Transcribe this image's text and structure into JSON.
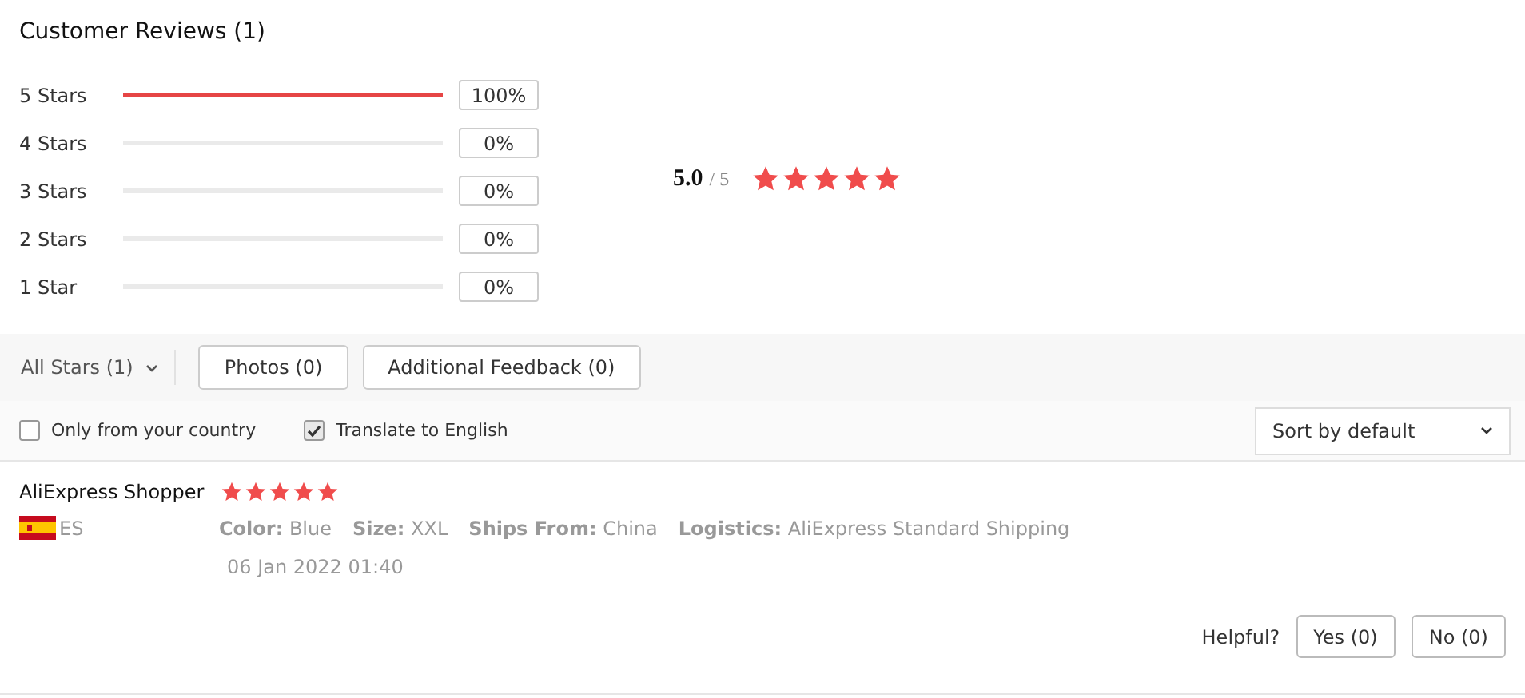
{
  "title": "Customer Reviews (1)",
  "distribution": [
    {
      "label": "5 Stars",
      "level": 1,
      "percent": "100%"
    },
    {
      "label": "4 Stars",
      "level": 0,
      "percent": "0%"
    },
    {
      "label": "3 Stars",
      "level": 0,
      "percent": "0%"
    },
    {
      "label": "2 Stars",
      "level": 0,
      "percent": "0%"
    },
    {
      "label": "1 Star",
      "level": 0,
      "percent": "0%"
    }
  ],
  "average": {
    "score": "5.0",
    "out_of": "/ 5",
    "stars": 5
  },
  "filters": {
    "dropdown": "All Stars (1)",
    "buttons": [
      "Photos (0)",
      "Additional Feedback (0)"
    ]
  },
  "options": [
    {
      "label": "Only from your country",
      "checked": false
    },
    {
      "label": "Translate to English",
      "checked": true
    }
  ],
  "sort": "Sort by default",
  "review": {
    "author": "AliExpress Shopper",
    "stars": 5,
    "country": "ES",
    "attributes": [
      {
        "name": "Color:",
        "value": "Blue"
      },
      {
        "name": "Size:",
        "value": "XXL"
      },
      {
        "name": "Ships From:",
        "value": "China"
      },
      {
        "name": "Logistics:",
        "value": "AliExpress Standard Shipping"
      }
    ],
    "date": "06 Jan 2022 01:40",
    "helpful_label": "Helpful?",
    "helpful_buttons": [
      "Yes (0)",
      "No (0)"
    ]
  }
}
